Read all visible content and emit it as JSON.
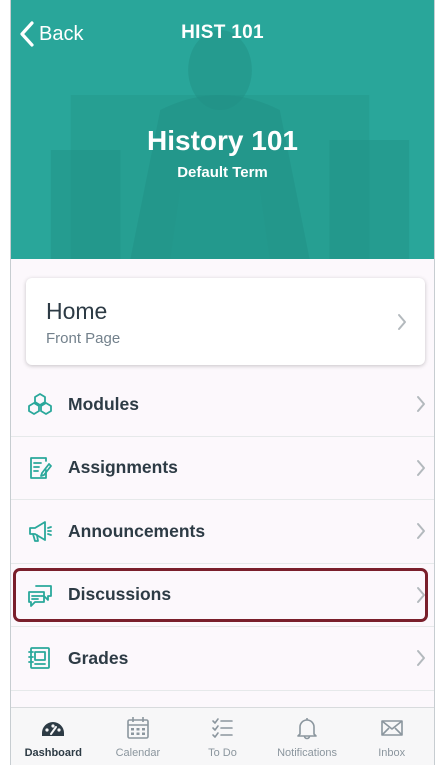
{
  "nav": {
    "back_label": "Back",
    "title": "HIST 101"
  },
  "course": {
    "name": "History 101",
    "term": "Default Term",
    "color": "#26a69a"
  },
  "home_card": {
    "title": "Home",
    "subtitle": "Front Page"
  },
  "menu": {
    "items": [
      {
        "label": "Modules",
        "icon": "modules-icon"
      },
      {
        "label": "Assignments",
        "icon": "assignments-icon"
      },
      {
        "label": "Announcements",
        "icon": "announcements-icon"
      },
      {
        "label": "Discussions",
        "icon": "discussions-icon",
        "highlighted": true
      },
      {
        "label": "Grades",
        "icon": "grades-icon"
      }
    ]
  },
  "tabbar": {
    "tabs": [
      {
        "label": "Dashboard",
        "icon": "dashboard-icon",
        "active": true
      },
      {
        "label": "Calendar",
        "icon": "calendar-icon"
      },
      {
        "label": "To Do",
        "icon": "todo-icon"
      },
      {
        "label": "Notifications",
        "icon": "bell-icon"
      },
      {
        "label": "Inbox",
        "icon": "inbox-icon"
      }
    ]
  },
  "colors": {
    "accent": "#26a69a",
    "icon": "#2aa89b",
    "highlight_border": "#7a1f2b"
  }
}
